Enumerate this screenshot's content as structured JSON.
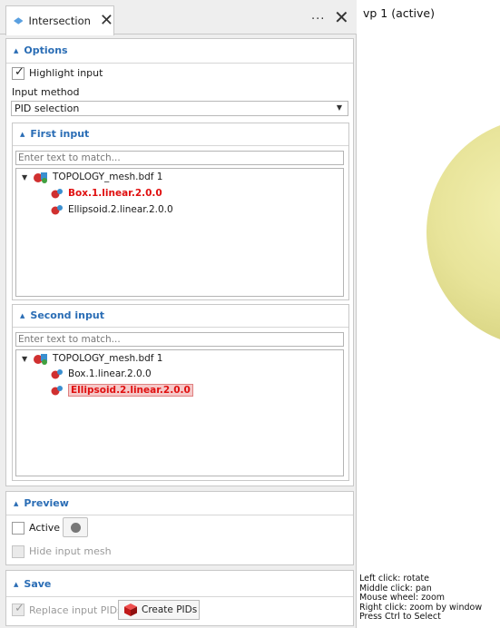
{
  "tab": {
    "label": "Intersection",
    "more_label": "···"
  },
  "options": {
    "title": "Options",
    "highlight_label": "Highlight input",
    "highlight_checked": true,
    "input_method_label": "Input method",
    "input_method_value": "PID selection"
  },
  "first_input": {
    "title": "First input",
    "filter_placeholder": "Enter text to match...",
    "root": "TOPOLOGY_mesh.bdf 1",
    "items": [
      "Box.1.linear.2.0.0",
      "Ellipsoid.2.linear.2.0.0"
    ],
    "selected_item": "Box.1.linear.2.0.0"
  },
  "second_input": {
    "title": "Second input",
    "filter_placeholder": "Enter text to match...",
    "root": "TOPOLOGY_mesh.bdf 1",
    "items": [
      "Box.1.linear.2.0.0",
      "Ellipsoid.2.linear.2.0.0"
    ],
    "selected_item": "Ellipsoid.2.linear.2.0.0"
  },
  "preview": {
    "title": "Preview",
    "active_label": "Active",
    "hide_label": "Hide input mesh"
  },
  "save": {
    "title": "Save",
    "replace_label": "Replace input PIDs",
    "create_label": "Create PIDs"
  },
  "viewport": {
    "title": "vp 1 (active)",
    "help": [
      "Left click: rotate",
      "Middle click: pan",
      "Mouse wheel: zoom",
      "Right click: zoom by window",
      "Press Ctrl to Select"
    ]
  },
  "colors": {
    "accent": "#2a6db5",
    "selection_red": "#e01010",
    "sphere": "#e8e49a"
  }
}
